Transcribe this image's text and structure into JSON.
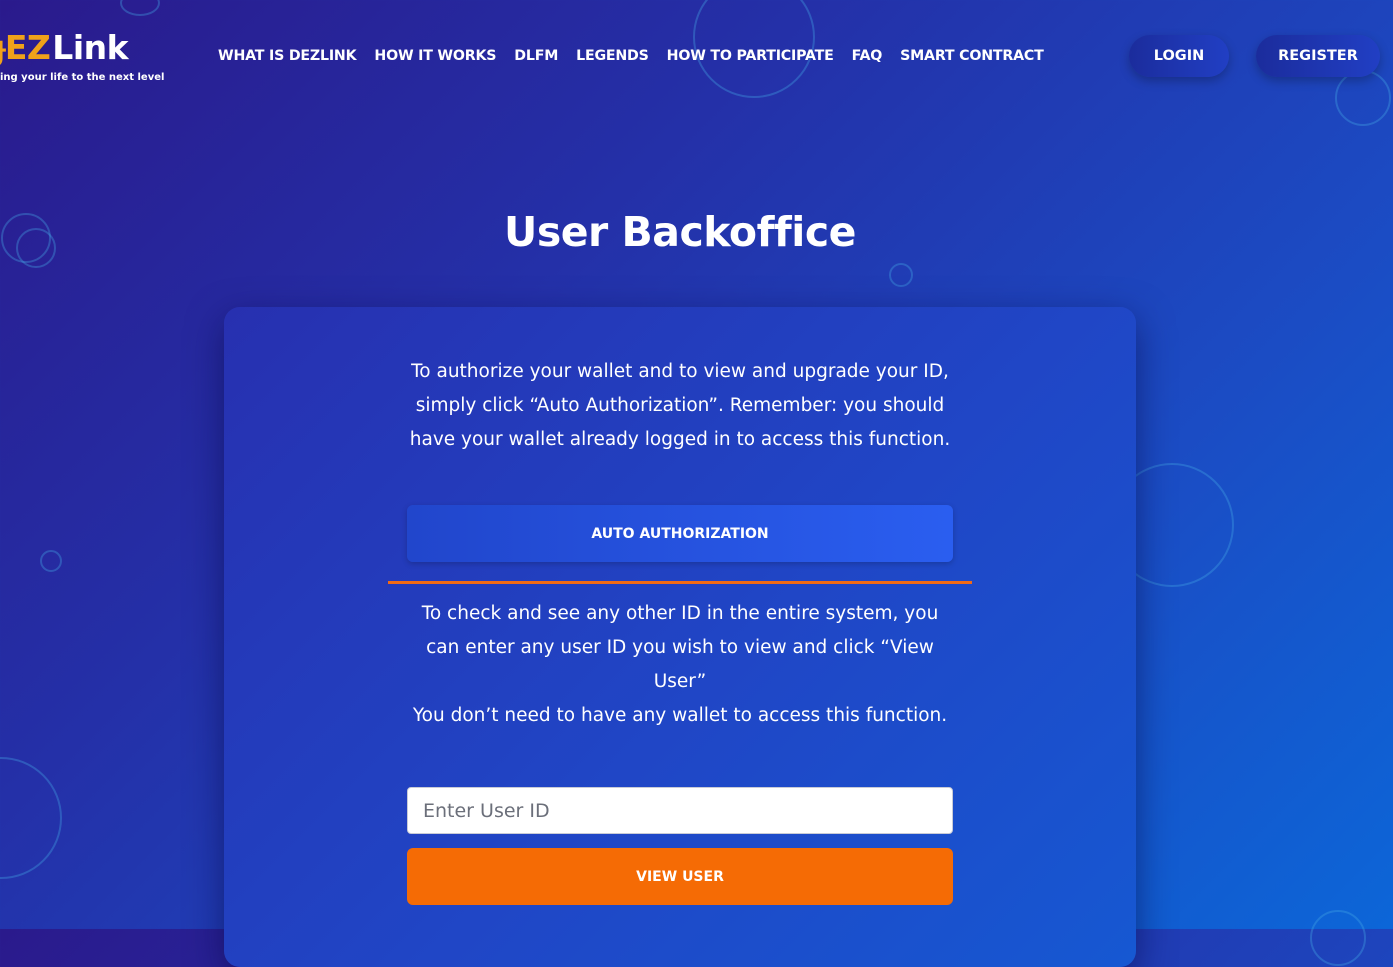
{
  "brand": {
    "logo_word_ez": "EZ",
    "logo_word_link": "Link",
    "tagline": "ing your life to the next level",
    "accent_color": "#f0a21a"
  },
  "nav": {
    "items": [
      {
        "label": "WHAT IS DEZLINK"
      },
      {
        "label": "HOW IT WORKS"
      },
      {
        "label": "DLFM"
      },
      {
        "label": "LEGENDS"
      },
      {
        "label": "HOW TO PARTICIPATE"
      },
      {
        "label": "FAQ"
      },
      {
        "label": "SMART CONTRACT"
      }
    ],
    "login_label": "LOGIN",
    "register_label": "REGISTER"
  },
  "page": {
    "title": "User Backoffice"
  },
  "card": {
    "auth_text": "To authorize your wallet and to view and upgrade your ID, simply click “Auto Authorization”. Remember: you should have your wallet already logged in to access this function.",
    "auth_button_label": "AUTO AUTHORIZATION",
    "view_text_1": "To check and see any other ID in the entire system, you can enter any user ID you wish to view and click “View User”",
    "view_text_2": "You don’t need to have any wallet to access this function.",
    "user_id_placeholder": "Enter User ID",
    "user_id_value": "",
    "view_button_label": "VIEW USER"
  },
  "colors": {
    "orange_accent": "#f56b05",
    "divider": "#f26a14",
    "primary_blue": "#2a5ef0"
  }
}
